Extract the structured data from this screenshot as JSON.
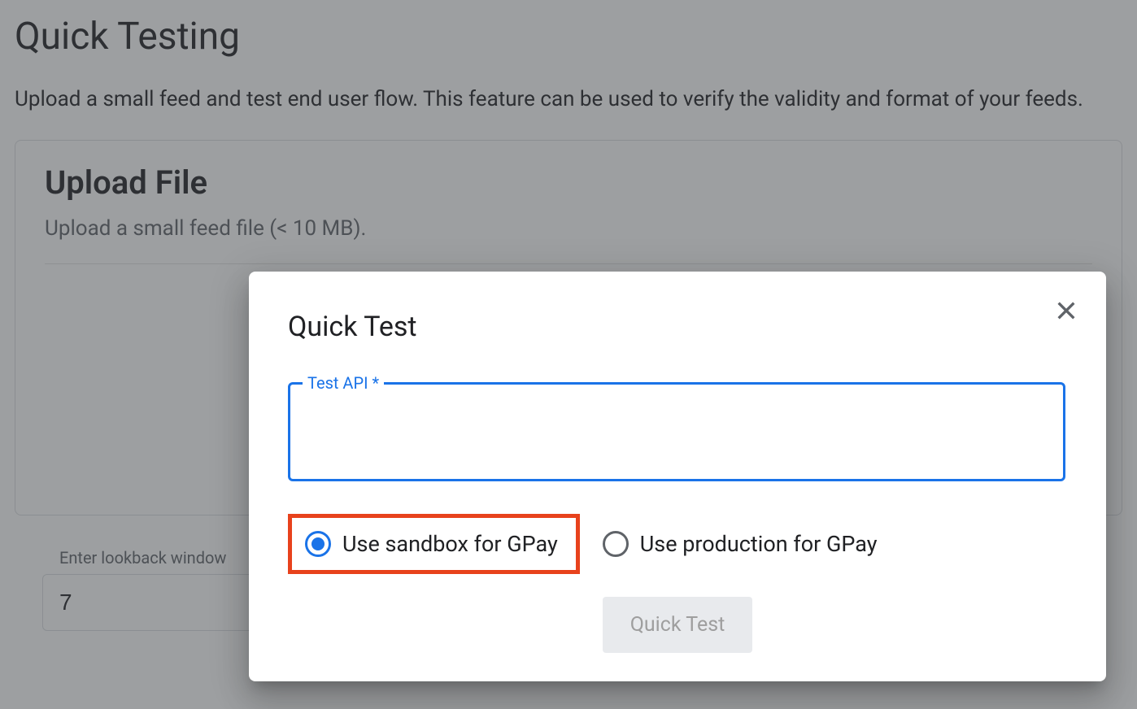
{
  "page": {
    "title": "Quick Testing",
    "subtitle": "Upload a small feed and test end user flow. This feature can be used to verify the validity and format of your feeds."
  },
  "uploadCard": {
    "title": "Upload File",
    "subtitle": "Upload a small feed file (< 10 MB)."
  },
  "lookback": {
    "label": "Enter lookback window",
    "value": "7"
  },
  "dialog": {
    "title": "Quick Test",
    "fieldLabel": "Test API *",
    "fieldValue": "",
    "radioSandbox": "Use sandbox for GPay",
    "radioProduction": "Use production for GPay",
    "actionButton": "Quick Test"
  }
}
